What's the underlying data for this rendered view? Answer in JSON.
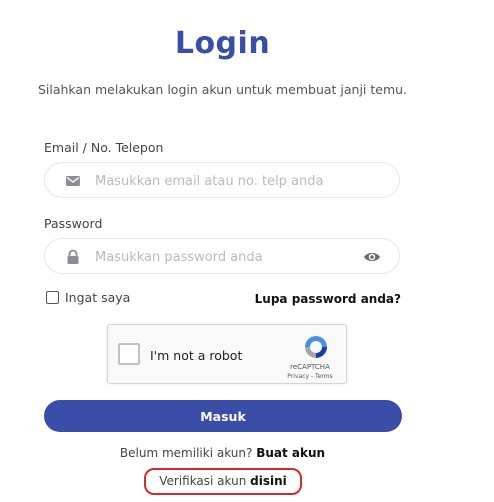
{
  "header": {
    "title": "Login",
    "subtitle": "Silahkan melakukan login akun untuk membuat janji temu."
  },
  "form": {
    "email_label": "Email / No. Telepon",
    "email_placeholder": "Masukkan email atau no. telp anda",
    "email_value": "",
    "password_label": "Password",
    "password_placeholder": "Masukkan password anda",
    "password_value": "",
    "remember_label": "Ingat saya",
    "remember_checked": false,
    "forgot_label": "Lupa password anda?",
    "submit_label": "Masuk"
  },
  "captcha": {
    "label": "I'm not a robot",
    "brand": "reCAPTCHA",
    "privacy": "Privacy",
    "separator": " - ",
    "terms": "Terms"
  },
  "footer": {
    "register_prefix": "Belum memiliki akun?",
    "register_link": "Buat akun",
    "verify_prefix": "Verifikasi akun",
    "verify_link": "disini",
    "highlight_color": "#d12b2b"
  },
  "icons": {
    "email": "envelope-icon",
    "password": "lock-icon",
    "toggle": "eye-icon",
    "captcha": "recaptcha-logo-icon"
  },
  "colors": {
    "accent": "#3a4ea8"
  }
}
